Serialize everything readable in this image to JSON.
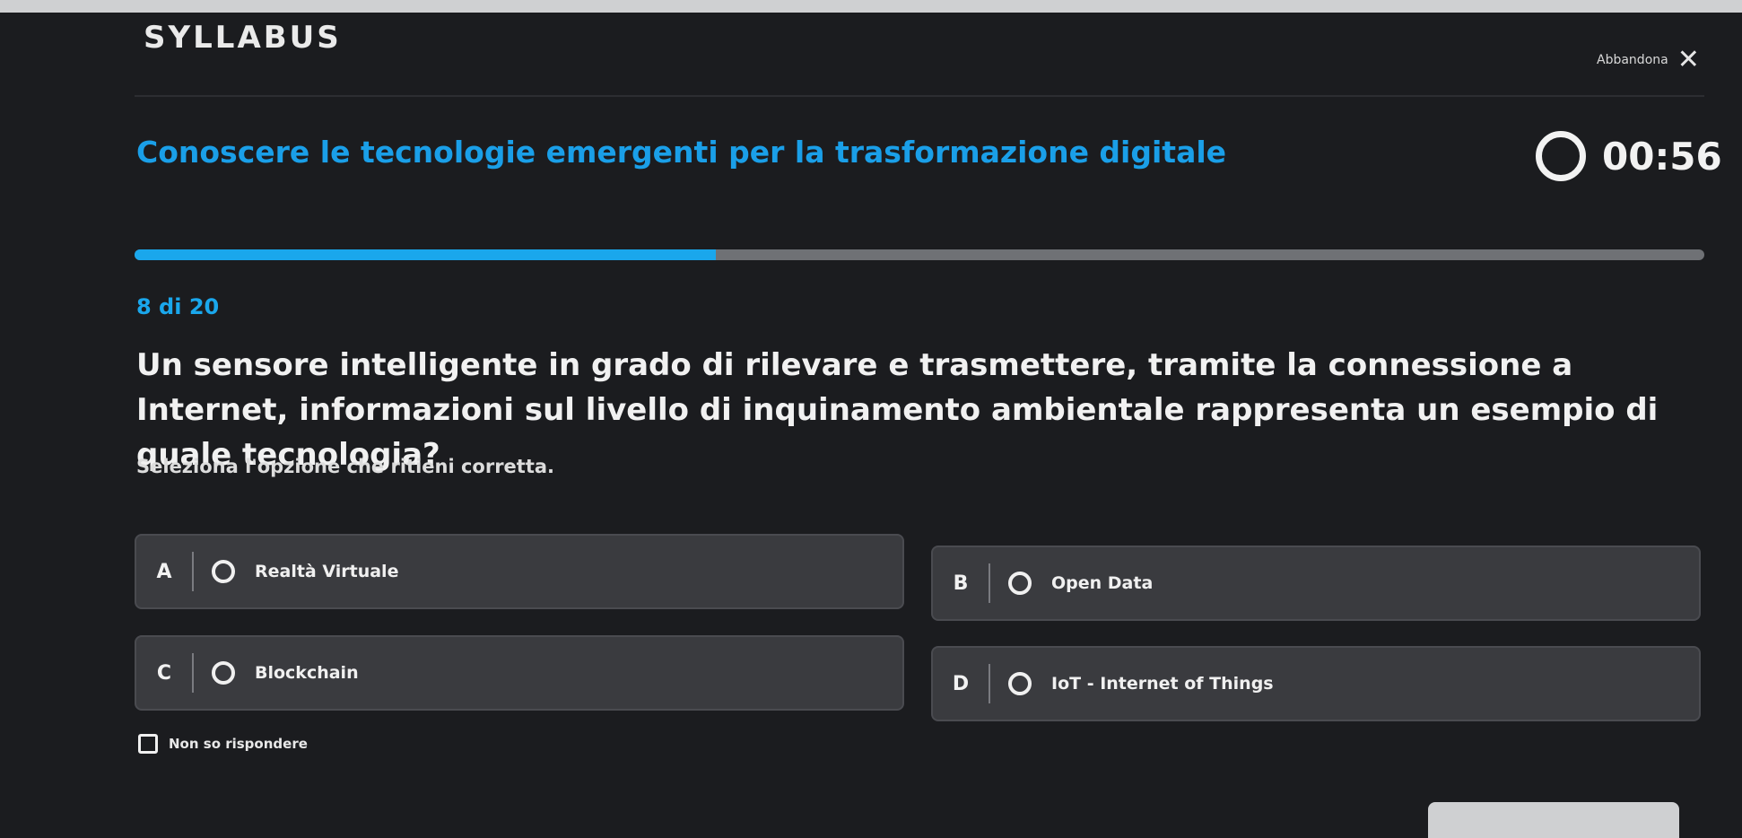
{
  "header": {
    "logo_text": "SYLLABUS",
    "abandon_label": "Abbandona",
    "close_icon": "close-icon"
  },
  "quiz": {
    "title": "Conoscere le tecnologie emergenti per la trasformazione digitale",
    "timer": "00:56",
    "progress_fraction": 0.37,
    "counter": "8 di 20",
    "question": "Un sensore intelligente in grado di rilevare e trasmettere, tramite la connessione a Internet, informazioni sul livello di inquinamento ambientale rappresenta un esempio di quale tecnologia?",
    "instruction": "Seleziona l'opzione che ritieni corretta.",
    "options": [
      {
        "letter": "A",
        "label": "Realtà Virtuale"
      },
      {
        "letter": "B",
        "label": "Open Data"
      },
      {
        "letter": "C",
        "label": "Blockchain"
      },
      {
        "letter": "D",
        "label": "IoT - Internet of Things"
      }
    ],
    "dont_know_label": "Non so rispondere"
  },
  "colors": {
    "accent": "#1aa7ec",
    "background": "#1b1c1f",
    "option_bg": "#3a3b3f"
  }
}
